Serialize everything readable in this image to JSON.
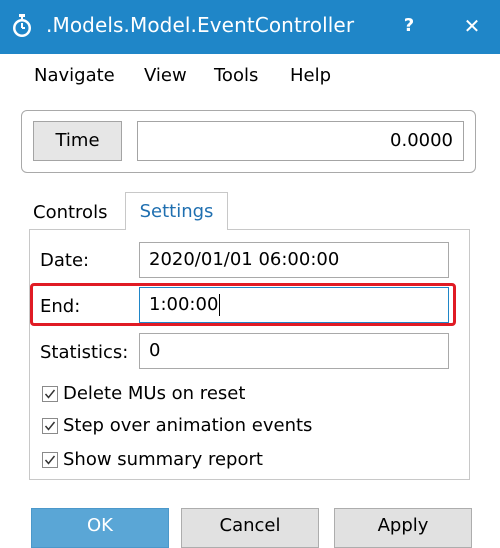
{
  "window": {
    "title": ".Models.Model.EventController",
    "help_label": "?",
    "close_label": "✕"
  },
  "menu": {
    "items": [
      "Navigate",
      "View",
      "Tools",
      "Help"
    ]
  },
  "time": {
    "button_label": "Time",
    "value": "0.0000"
  },
  "tabs": {
    "controls": "Controls",
    "settings": "Settings"
  },
  "settings": {
    "date_label": "Date:",
    "date_value": "2020/01/01 06:00:00",
    "end_label": "End:",
    "end_value": "1:00:00",
    "statistics_label": "Statistics:",
    "statistics_value": "0",
    "checkboxes": [
      {
        "label": "Delete MUs on reset",
        "checked": true
      },
      {
        "label": "Step over animation events",
        "checked": true
      },
      {
        "label": "Show summary report",
        "checked": true
      }
    ]
  },
  "buttons": {
    "ok": "OK",
    "cancel": "Cancel",
    "apply": "Apply"
  },
  "colors": {
    "titlebar": "#1f86c8",
    "highlight": "#e01b24",
    "active_tab_text": "#1f6fb0"
  }
}
